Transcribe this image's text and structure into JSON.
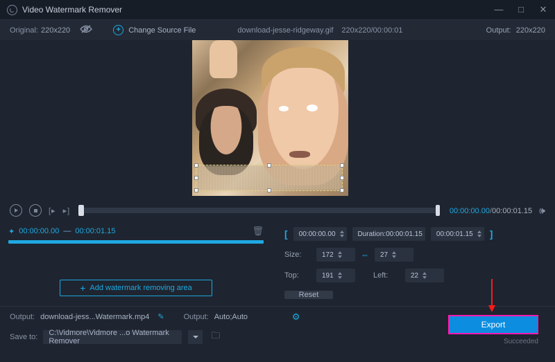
{
  "titlebar": {
    "title": "Video Watermark Remover"
  },
  "infobar": {
    "original_label": "Original:",
    "original_dim": "220x220",
    "change_source": "Change Source File",
    "filename": "download-jesse-ridgeway.gif",
    "fileinfo": "220x220/00:00:01",
    "output_label": "Output:",
    "output_dim": "220x220"
  },
  "playbar": {
    "current_time": "00:00:00.00",
    "total_time": "00:00:01.15"
  },
  "segment": {
    "start": "00:00:00.00",
    "end": "00:00:01.15"
  },
  "area_panel": {
    "add_label": "Add watermark removing area",
    "timebox1": "00:00:00.00",
    "duration_label": "Duration:",
    "duration_val": "00:00:01.15",
    "timebox2": "00:00:01.15",
    "size_label": "Size:",
    "size_w": "172",
    "size_h": "27",
    "top_label": "Top:",
    "top_val": "191",
    "left_label": "Left:",
    "left_val": "22",
    "reset": "Reset"
  },
  "footer": {
    "output_label": "Output:",
    "output_file": "download-jess...Watermark.mp4",
    "output2_label": "Output:",
    "output2_val": "Auto;Auto",
    "save_label": "Save to:",
    "save_path": "C:\\Vidmore\\Vidmore ...o Watermark Remover",
    "export": "Export",
    "status": "Succeeded"
  }
}
